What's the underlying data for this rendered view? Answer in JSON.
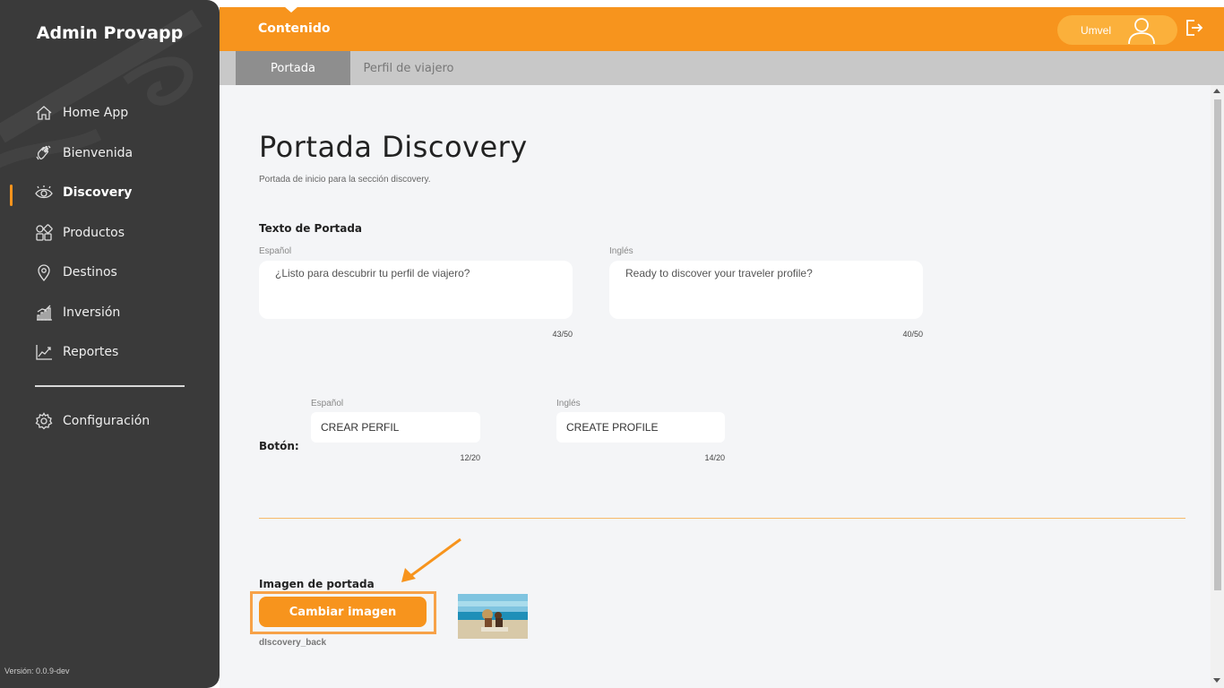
{
  "sidebar": {
    "app_title": "Admin Provapp",
    "items": [
      {
        "label": "Home App",
        "icon": "home-icon"
      },
      {
        "label": "Bienvenida",
        "icon": "waving-hand-icon"
      },
      {
        "label": "Discovery",
        "icon": "eye-icon",
        "active": true
      },
      {
        "label": "Productos",
        "icon": "products-grid-icon"
      },
      {
        "label": "Destinos",
        "icon": "location-pin-icon"
      },
      {
        "label": "Inversión",
        "icon": "bar-chart-icon"
      },
      {
        "label": "Reportes",
        "icon": "line-chart-icon"
      }
    ],
    "settings_label": "Configuración",
    "settings_icon": "gear-icon",
    "version": "Versión: 0.0.9-dev"
  },
  "topbar": {
    "title": "Contenido",
    "user_name": "Umvel",
    "avatar_icon": "user-icon",
    "logout_icon": "logout-icon"
  },
  "tabs": [
    {
      "label": "Portada",
      "active": true
    },
    {
      "label": "Perfil de viajero",
      "active": false
    }
  ],
  "page": {
    "title": "Portada Discovery",
    "subtitle": "Portada de inicio para la sección discovery."
  },
  "cover_text": {
    "section_label": "Texto de Portada",
    "es_label": "Español",
    "es_value": "¿Listo para descubrir tu perfil de viajero?",
    "es_counter": "43/50",
    "en_label": "Inglés",
    "en_value": "Ready to discover your traveler profile?",
    "en_counter": "40/50"
  },
  "button_text": {
    "section_label": "Botón:",
    "es_label": "Español",
    "es_value": "CREAR PERFIL",
    "es_counter": "12/20",
    "en_label": "Inglés",
    "en_value": "CREATE PROFILE",
    "en_counter": "14/20"
  },
  "cover_image": {
    "section_label": "Imagen de portada",
    "change_button": "Cambiar imagen",
    "file_name": "dIscovery_back"
  },
  "colors": {
    "accent": "#f7941d",
    "sidebar_bg": "#3a3a3a",
    "content_bg": "#f4f5f7"
  }
}
